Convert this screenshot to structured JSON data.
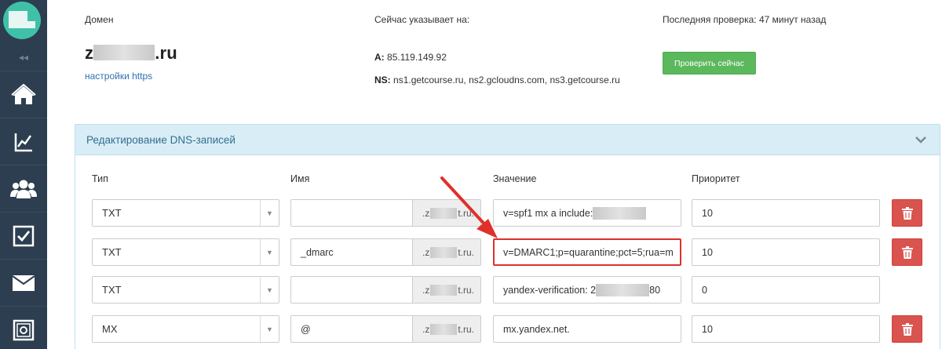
{
  "header": {
    "domain_label": "Домен",
    "domain_suffix": ".ru",
    "domain_prefix": "z",
    "https_link": "настройки https",
    "pointing_label": "Сейчас указывает на:",
    "a_key": "A:",
    "a_value": "85.119.149.92",
    "ns_key": "NS:",
    "ns_value": "ns1.getcourse.ru, ns2.gcloudns.com, ns3.getcourse.ru",
    "last_check": "Последняя проверка: 47 минут назад",
    "check_button": "Проверить сейчас"
  },
  "panel": {
    "title": "Редактирование DNS-записей",
    "columns": {
      "type": "Тип",
      "name": "Имя",
      "value": "Значение",
      "priority": "Приоритет"
    },
    "rows": [
      {
        "type": "TXT",
        "name": "",
        "addon_prefix": ".z",
        "addon_suffix": "t.ru.",
        "value": "v=spf1 mx a include:",
        "priority": "10"
      },
      {
        "type": "TXT",
        "name": "_dmarc",
        "addon_prefix": ".z",
        "addon_suffix": "t.ru.",
        "value": "v=DMARC1;p=quarantine;pct=5;rua=m",
        "priority": "10"
      },
      {
        "type": "TXT",
        "name": "",
        "addon_prefix": ".z",
        "addon_suffix": "t.ru.",
        "value": "yandex-verification: 2",
        "value_tail": "80",
        "priority": "0"
      },
      {
        "type": "MX",
        "name": "@",
        "addon_prefix": ".z",
        "addon_suffix": "t.ru.",
        "value": "mx.yandex.net.",
        "priority": "10"
      }
    ]
  },
  "colors": {
    "sidebar": "#2c3e50",
    "logo": "#3fc1a8",
    "panel_header": "#d9edf7",
    "success": "#5cb85c",
    "danger": "#d9534f",
    "annotation": "#d9322b"
  },
  "icons": [
    "logo-icon",
    "collapse-icon",
    "home-icon",
    "chart-icon",
    "users-icon",
    "checkbox-icon",
    "mail-icon",
    "safe-icon",
    "chevron-down-icon",
    "trash-icon",
    "arrow-annotation"
  ]
}
